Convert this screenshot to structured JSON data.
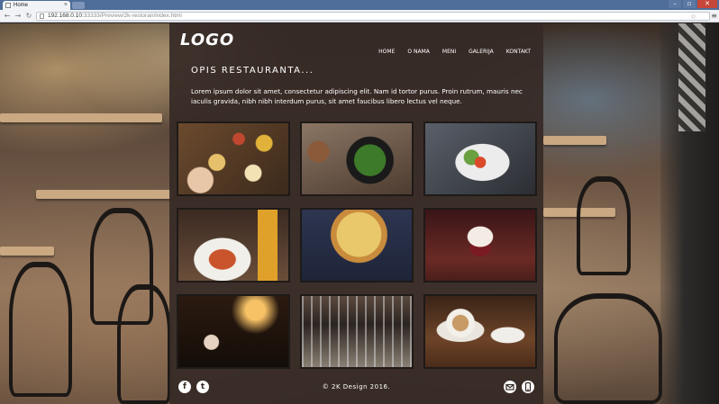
{
  "browser": {
    "tab_title": "Home",
    "tab_close": "×",
    "url_host": "192.168.0.10:",
    "url_path": "33333/Preview/2k-restoran/index.html",
    "back_icon": "arrow-left-icon",
    "forward_icon": "arrow-right-icon",
    "reload_icon": "reload-icon",
    "star_icon": "☆",
    "menu_icon": "≡",
    "min_glyph": "–",
    "max_glyph": "▫",
    "close_glyph": "✕"
  },
  "site": {
    "logo": "LOGO",
    "nav": [
      "HOME",
      "O NAMA",
      "MENI",
      "GALERIJA",
      "KONTAKT"
    ],
    "intro_title": "OPIS RESTAURANTA...",
    "intro_text": "Lorem ipsum dolor sit amet, consectetur adipiscing elit. Nam id tortor purus. Proin rutrum, mauris nec iaculis gravida, nibh nibh interdum purus, sit amet faucibus libero lectus vel neque.",
    "gallery": [
      {
        "name": "tapas-platter"
      },
      {
        "name": "green-salad-bowl"
      },
      {
        "name": "tomato-salad-plate"
      },
      {
        "name": "pasta-and-beer"
      },
      {
        "name": "pizza"
      },
      {
        "name": "ice-cream-dessert"
      },
      {
        "name": "wine-bar"
      },
      {
        "name": "hanging-wine-glasses"
      },
      {
        "name": "coffee-cup"
      }
    ],
    "footer": {
      "facebook_glyph": "f",
      "twitter_glyph": "t",
      "copyright": "© 2K Design 2016.",
      "mail_icon": "envelope-icon",
      "phone_icon": "phone-icon"
    }
  },
  "colors": {
    "browser_tabbar": "#4e6d98",
    "site_panel": "#362a26",
    "text": "#ffffff"
  }
}
